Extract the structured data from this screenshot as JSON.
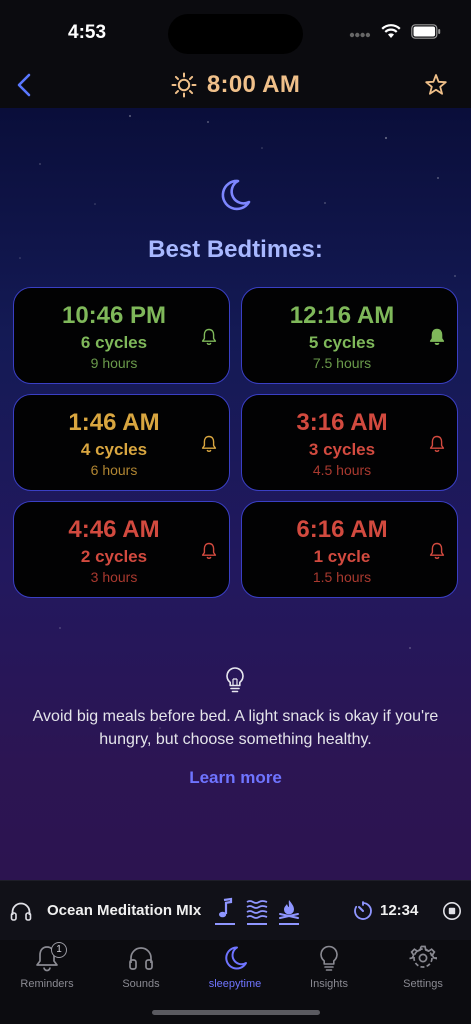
{
  "status": {
    "time": "4:53"
  },
  "header": {
    "wake_time": "8:00 AM"
  },
  "main": {
    "title": "Best Bedtimes:",
    "bedtimes": [
      {
        "time": "10:46 PM",
        "cycles": "6 cycles",
        "hours": "9 hours",
        "tone": "green",
        "bell_filled": false
      },
      {
        "time": "12:16 AM",
        "cycles": "5 cycles",
        "hours": "7.5 hours",
        "tone": "green",
        "bell_filled": true
      },
      {
        "time": "1:46 AM",
        "cycles": "4 cycles",
        "hours": "6 hours",
        "tone": "yellow",
        "bell_filled": false
      },
      {
        "time": "3:16 AM",
        "cycles": "3 cycles",
        "hours": "4.5 hours",
        "tone": "red",
        "bell_filled": false
      },
      {
        "time": "4:46 AM",
        "cycles": "2 cycles",
        "hours": "3 hours",
        "tone": "red",
        "bell_filled": false
      },
      {
        "time": "6:16 AM",
        "cycles": "1 cycle",
        "hours": "1.5 hours",
        "tone": "red",
        "bell_filled": false
      }
    ],
    "tip": "Avoid big meals before bed. A light snack is okay if you're hungry, but choose something healthy.",
    "learn_more": "Learn more"
  },
  "player": {
    "title": "Ocean Meditation MIx",
    "timer": "12:34"
  },
  "tabs": [
    {
      "label": "Reminders",
      "icon": "bell-icon",
      "badge": "1"
    },
    {
      "label": "Sounds",
      "icon": "headphones-icon"
    },
    {
      "label": "sleepytime",
      "icon": "moon-icon",
      "active": true
    },
    {
      "label": "Insights",
      "icon": "lightbulb-icon"
    },
    {
      "label": "Settings",
      "icon": "gear-icon"
    }
  ],
  "colors": {
    "accent": "#6f74ff",
    "card_border": "#3a3fc4",
    "good": "#7fb85a",
    "ok": "#d9a640",
    "bad": "#d24a3f",
    "wake_time": "#f0c08a"
  }
}
